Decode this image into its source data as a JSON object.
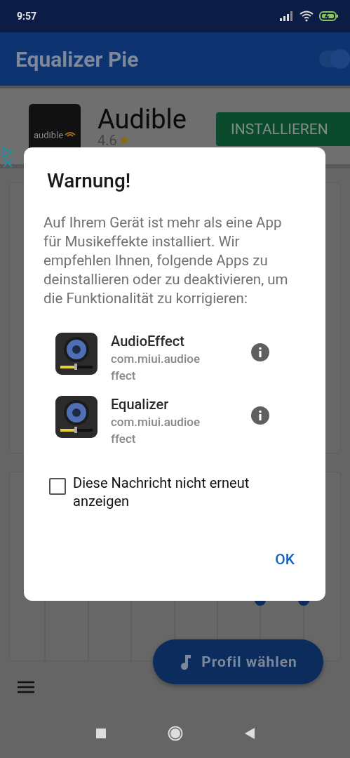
{
  "status_bar": {
    "time": "9:57"
  },
  "app_bar": {
    "title": "Equalizer Pie",
    "toggle": {
      "on": true
    }
  },
  "ad": {
    "app_name": "Audible",
    "logo_text": "audible",
    "rating": "4.6",
    "button": "INSTALLIEREN"
  },
  "dialog": {
    "title": "Warnung!",
    "message": "Auf Ihrem Gerät ist mehr als eine App für Musikeffekte installiert. Wir empfehlen Ihnen, folgende Apps zu deinstallieren oder zu deaktivieren, um die Funktionalität zu korrigieren:",
    "apps": [
      {
        "name": "AudioEffect",
        "package": "com.miui.audioeffect"
      },
      {
        "name": "Equalizer",
        "package": "com.miui.audioeffect"
      }
    ],
    "checkbox": {
      "label": "Diese Nachricht nicht erneut anzeigen",
      "checked": false
    },
    "button": "OK"
  },
  "profile_button": "Profil wählen"
}
